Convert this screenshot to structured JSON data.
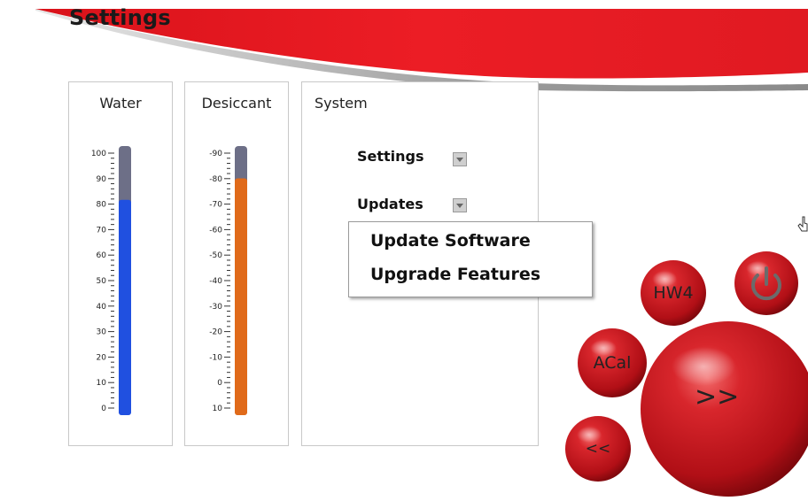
{
  "header": {
    "title": "Settings"
  },
  "panels": {
    "water": {
      "title": "Water",
      "fill_level_percent": 80,
      "tick_labels": [
        "100",
        "90",
        "80",
        "70",
        "60",
        "50",
        "40",
        "30",
        "20",
        "10",
        "0"
      ],
      "fill_color": "#2050e0"
    },
    "desiccant": {
      "title": "Desiccant",
      "fill_level_fraction": 0.88,
      "tick_labels": [
        "-90",
        "-80",
        "-70",
        "-60",
        "-50",
        "-40",
        "-30",
        "-20",
        "-10",
        "0",
        "10"
      ],
      "fill_color": "#e06a1a"
    },
    "system": {
      "title": "System",
      "settings_label": "Settings",
      "updates_label": "Updates"
    }
  },
  "popup_menu": {
    "items": [
      "Update Software",
      "Upgrade Features"
    ]
  },
  "buttons": {
    "hw4": "HW4",
    "acal": "ACal",
    "forward": ">>",
    "back": "<<",
    "power_icon": "power-icon"
  },
  "colors": {
    "header_red": "#e4161f",
    "header_gray": "#8a8a8a",
    "gauge_empty": "#6d6f87",
    "ball_red": "#c8141c"
  }
}
